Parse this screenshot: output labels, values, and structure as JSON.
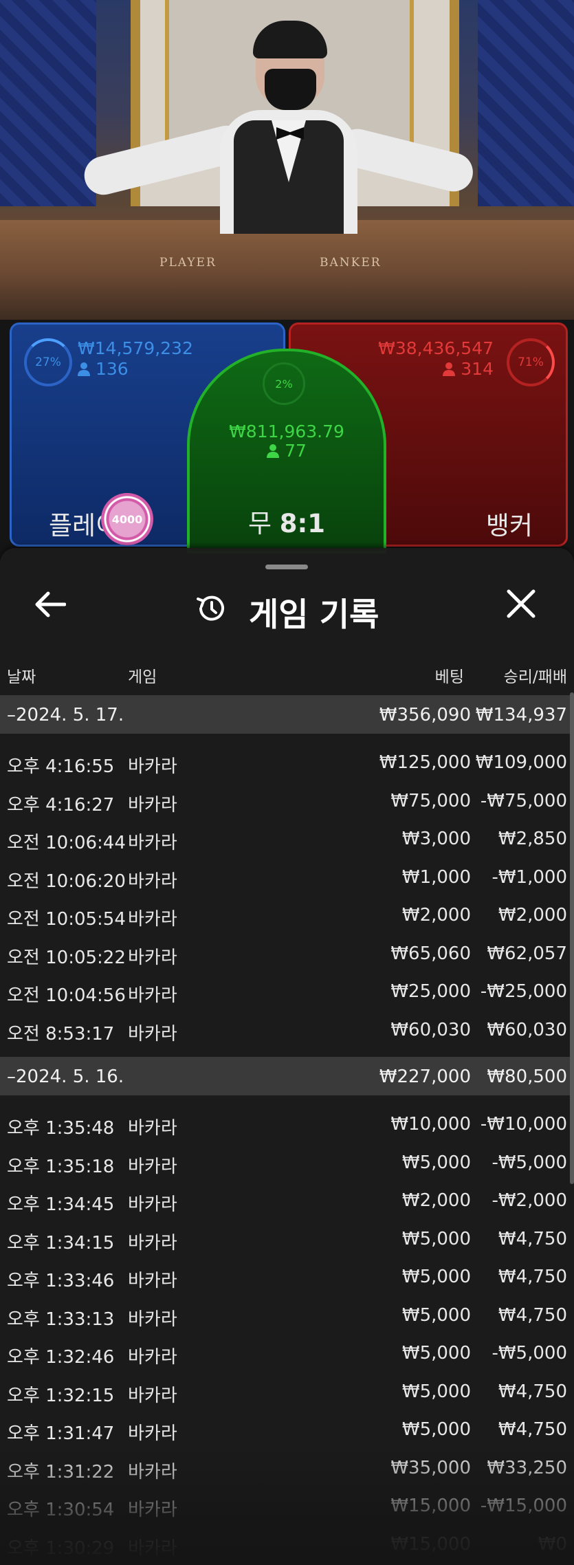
{
  "table_labels": {
    "player": "PLAYER",
    "banker": "BANKER"
  },
  "bets": {
    "player": {
      "percent": "27%",
      "amount": "₩14,579,232",
      "count": "136",
      "label": "플레이"
    },
    "tie": {
      "percent": "2%",
      "amount": "₩811,963.79",
      "count": "77",
      "label": "무",
      "payout": "8:1"
    },
    "banker": {
      "percent": "71%",
      "amount": "₩38,436,547",
      "count": "314",
      "label": "뱅커"
    },
    "chip": "4000"
  },
  "panel": {
    "title": "게임 기록",
    "columns": {
      "date": "날짜",
      "game": "게임",
      "bet": "베팅",
      "winloss": "승리/패배"
    },
    "groups": [
      {
        "date": "–2024. 5. 17.",
        "bet": "₩356,090",
        "winloss": "₩134,937",
        "rows": [
          {
            "time": "오후 4:16:55",
            "game": "바카라",
            "bet": "₩125,000",
            "winloss": "₩109,000"
          },
          {
            "time": "오후 4:16:27",
            "game": "바카라",
            "bet": "₩75,000",
            "winloss": "-₩75,000"
          },
          {
            "time": "오전 10:06:44",
            "game": "바카라",
            "bet": "₩3,000",
            "winloss": "₩2,850"
          },
          {
            "time": "오전 10:06:20",
            "game": "바카라",
            "bet": "₩1,000",
            "winloss": "-₩1,000"
          },
          {
            "time": "오전 10:05:54",
            "game": "바카라",
            "bet": "₩2,000",
            "winloss": "₩2,000"
          },
          {
            "time": "오전 10:05:22",
            "game": "바카라",
            "bet": "₩65,060",
            "winloss": "₩62,057"
          },
          {
            "time": "오전 10:04:56",
            "game": "바카라",
            "bet": "₩25,000",
            "winloss": "-₩25,000"
          },
          {
            "time": "오전 8:53:17",
            "game": "바카라",
            "bet": "₩60,030",
            "winloss": "₩60,030"
          }
        ]
      },
      {
        "date": "–2024. 5. 16.",
        "bet": "₩227,000",
        "winloss": "₩80,500",
        "rows": [
          {
            "time": "오후 1:35:48",
            "game": "바카라",
            "bet": "₩10,000",
            "winloss": "-₩10,000"
          },
          {
            "time": "오후 1:35:18",
            "game": "바카라",
            "bet": "₩5,000",
            "winloss": "-₩5,000"
          },
          {
            "time": "오후 1:34:45",
            "game": "바카라",
            "bet": "₩2,000",
            "winloss": "-₩2,000"
          },
          {
            "time": "오후 1:34:15",
            "game": "바카라",
            "bet": "₩5,000",
            "winloss": "₩4,750"
          },
          {
            "time": "오후 1:33:46",
            "game": "바카라",
            "bet": "₩5,000",
            "winloss": "₩4,750"
          },
          {
            "time": "오후 1:33:13",
            "game": "바카라",
            "bet": "₩5,000",
            "winloss": "₩4,750"
          },
          {
            "time": "오후 1:32:46",
            "game": "바카라",
            "bet": "₩5,000",
            "winloss": "-₩5,000"
          },
          {
            "time": "오후 1:32:15",
            "game": "바카라",
            "bet": "₩5,000",
            "winloss": "₩4,750"
          },
          {
            "time": "오후 1:31:47",
            "game": "바카라",
            "bet": "₩5,000",
            "winloss": "₩4,750"
          },
          {
            "time": "오후 1:31:22",
            "game": "바카라",
            "bet": "₩35,000",
            "winloss": "₩33,250"
          },
          {
            "time": "오후 1:30:54",
            "game": "바카라",
            "bet": "₩15,000",
            "winloss": "-₩15,000"
          },
          {
            "time": "오후 1:30:29",
            "game": "바카라",
            "bet": "₩15,000",
            "winloss": "₩0"
          }
        ]
      }
    ]
  },
  "colors": {
    "player": "#2b63c6",
    "banker": "#b52222",
    "tie": "#22b129",
    "player_text": "#3d8fe6",
    "banker_text": "#e23a3a",
    "tie_text": "#3ed646"
  },
  "icons": {
    "back": "arrow-left-icon",
    "history": "history-icon",
    "close": "close-icon",
    "person": "person-icon"
  }
}
